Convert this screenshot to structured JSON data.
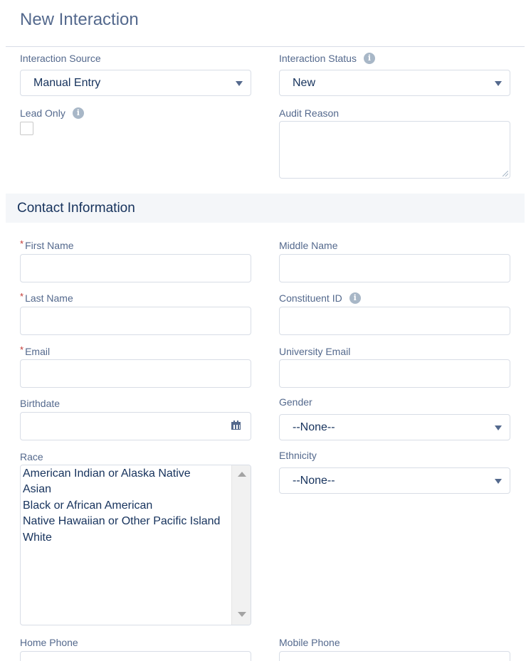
{
  "header": {
    "title": "New Interaction"
  },
  "interaction": {
    "source_label": "Interaction Source",
    "source_value": "Manual Entry",
    "status_label": "Interaction Status",
    "status_value": "New",
    "lead_only_label": "Lead Only",
    "lead_only_checked": false,
    "audit_reason_label": "Audit Reason",
    "audit_reason_value": ""
  },
  "contact": {
    "section_title": "Contact Information",
    "required_marker": "*",
    "first_name_label": "First Name",
    "middle_name_label": "Middle Name",
    "last_name_label": "Last Name",
    "constituent_id_label": "Constituent ID",
    "email_label": "Email",
    "university_email_label": "University Email",
    "birthdate_label": "Birthdate",
    "gender_label": "Gender",
    "gender_value": "--None--",
    "race_label": "Race",
    "race_options": [
      "American Indian or Alaska Native",
      "Asian",
      "Black or African American",
      "Native Hawaiian or Other Pacific Island",
      "White"
    ],
    "ethnicity_label": "Ethnicity",
    "ethnicity_value": "--None--",
    "home_phone_label": "Home Phone",
    "mobile_phone_label": "Mobile Phone"
  },
  "icons": {
    "info": "info-icon",
    "dropdown": "chevron-down-icon",
    "calendar": "calendar-icon",
    "info_glyph": "i"
  },
  "colors": {
    "label": "#54698d",
    "value": "#16325c",
    "required": "#c23934",
    "border": "#d8dde6",
    "section_bg": "#f4f6f9"
  }
}
